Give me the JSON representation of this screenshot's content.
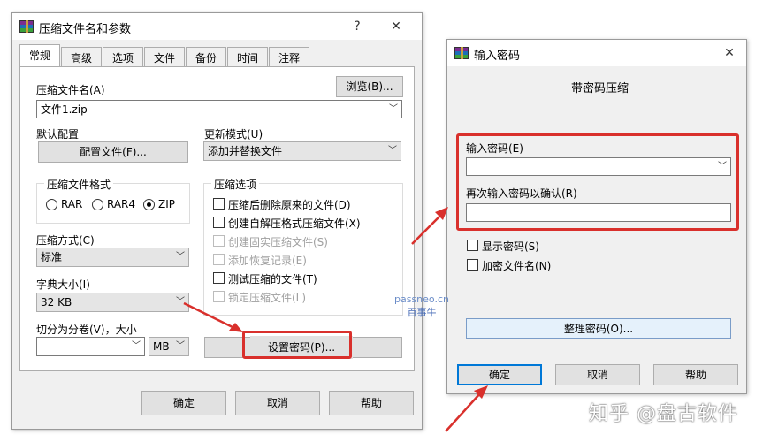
{
  "main_dialog": {
    "title": "压缩文件名和参数",
    "help_glyph": "?",
    "close_glyph": "✕",
    "tabs": [
      "常规",
      "高级",
      "选项",
      "文件",
      "备份",
      "时间",
      "注释"
    ],
    "archive_name_label": "压缩文件名(A)",
    "browse_button": "浏览(B)...",
    "archive_name_value": "文件1.zip",
    "default_profile_label": "默认配置",
    "profiles_button": "配置文件(F)...",
    "update_mode_label": "更新模式(U)",
    "update_mode_value": "添加并替换文件",
    "format_group_title": "压缩文件格式",
    "formats": [
      "RAR",
      "RAR4",
      "ZIP"
    ],
    "selected_format": "ZIP",
    "options_group_title": "压缩选项",
    "options": [
      {
        "label": "压缩后删除原来的文件(D)",
        "enabled": true
      },
      {
        "label": "创建自解压格式压缩文件(X)",
        "enabled": true
      },
      {
        "label": "创建固实压缩文件(S)",
        "enabled": false
      },
      {
        "label": "添加恢复记录(E)",
        "enabled": false
      },
      {
        "label": "测试压缩的文件(T)",
        "enabled": true
      },
      {
        "label": "锁定压缩文件(L)",
        "enabled": false
      }
    ],
    "method_label": "压缩方式(C)",
    "method_value": "标准",
    "dict_label": "字典大小(I)",
    "dict_value": "32 KB",
    "split_label": "切分为分卷(V)，大小",
    "split_value": "",
    "split_unit": "MB",
    "set_password_button": "设置密码(P)...",
    "ok_button": "确定",
    "cancel_button": "取消",
    "help_button": "帮助"
  },
  "password_dialog": {
    "title": "输入密码",
    "close_glyph": "✕",
    "heading": "带密码压缩",
    "enter_label": "输入密码(E)",
    "enter_value": "",
    "reenter_label": "再次输入密码以确认(R)",
    "reenter_value": "",
    "show_password_label": "显示密码(S)",
    "encrypt_names_label": "加密文件名(N)",
    "organize_button": "整理密码(O)...",
    "ok_button": "确定",
    "cancel_button": "取消",
    "help_button": "帮助"
  },
  "watermark": {
    "line1": "passneo.cn",
    "line2": "百事牛"
  },
  "brand": "知乎 @盘古软件",
  "colors": {
    "highlight_red": "#d9302c",
    "focus_blue": "#0078d7"
  }
}
